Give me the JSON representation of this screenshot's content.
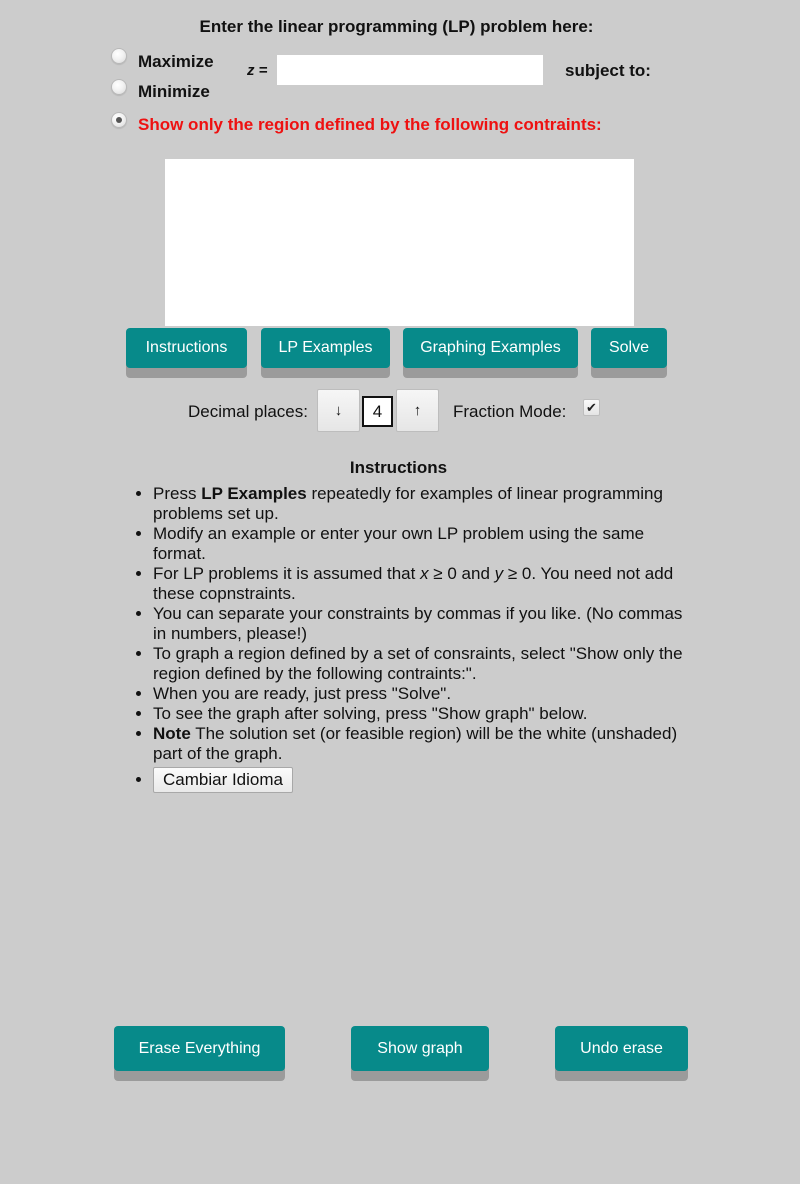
{
  "header": {
    "title": "Enter the linear programming (LP) problem here:"
  },
  "objective": {
    "options": [
      {
        "label": "Maximize",
        "checked": false
      },
      {
        "label": "Minimize",
        "checked": false
      },
      {
        "label": "Show only the region defined by the following contraints:",
        "checked": true
      }
    ],
    "z_label": "z =",
    "z_value": "",
    "subject_to": "subject to:"
  },
  "constraints": {
    "value": ""
  },
  "toolbar": {
    "instructions_label": "Instructions",
    "lp_examples_label": "LP Examples",
    "graphing_examples_label": "Graphing Examples",
    "solve_label": "Solve"
  },
  "settings": {
    "decimal_places_label": "Decimal places:",
    "decrease_icon": "↓",
    "increase_icon": "↑",
    "decimal_places_value": "4",
    "fraction_mode_label": "Fraction Mode:",
    "fraction_mode_checked": true,
    "check_icon": "✔"
  },
  "instructions": {
    "title": "Instructions",
    "items": [
      {
        "prefix": "Press ",
        "bold": "LP Examples",
        "text": " repeatedly for examples of linear programming problems set up."
      },
      {
        "text": "Modify an example or enter your own LP problem using the same format."
      },
      {
        "text_a": "For LP problems it is assumed that ",
        "var_x": "x",
        "text_b": " ≥ 0 and ",
        "var_y": "y",
        "text_c": " ≥ 0. You need not add these copnstraints."
      },
      {
        "text": "You can separate your constraints by commas if you like. (No commas in numbers, please!)"
      },
      {
        "text": "To graph a region defined by a set of consraints, select \"Show only the region defined by the following contraints:\"."
      },
      {
        "text": "When you are ready, just press \"Solve\"."
      },
      {
        "text": "To see the graph after solving, press \"Show graph\" below."
      },
      {
        "bold": "Note",
        "text": " The solution set (or feasible region) will be the white (unshaded) part of the graph."
      }
    ],
    "language_button": "Cambiar Idioma"
  },
  "footer": {
    "erase_label": "Erase Everything",
    "show_graph_label": "Show graph",
    "undo_label": "Undo erase"
  },
  "colors": {
    "button": "#078a8a",
    "button_shadow": "#9b9b9b",
    "background": "#cccccc",
    "highlight_red": "#ee1111"
  }
}
